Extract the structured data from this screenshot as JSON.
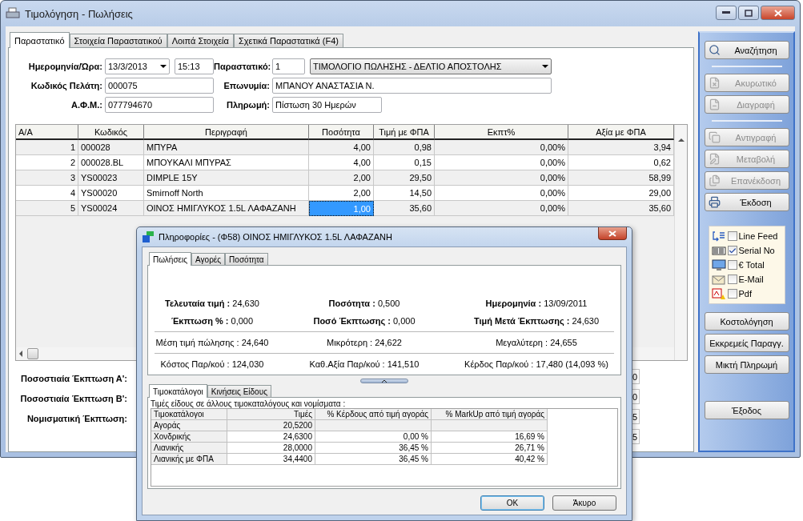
{
  "window": {
    "title": "Τιμολόγηση - Πωλήσεις"
  },
  "tabs": [
    {
      "label": "Παραστατικό",
      "selected": true
    },
    {
      "label": "Στοιχεία Παραστατικού",
      "selected": false
    },
    {
      "label": "Λοιπά Στοιχεία",
      "selected": false
    },
    {
      "label": "Σχετικά Παραστατικά (F4)",
      "selected": false
    }
  ],
  "form": {
    "date_label": "Ημερομηνία/Ώρα:",
    "date": "13/3/2013",
    "time": "15:13",
    "document_label": "Παραστατικό:",
    "document_number": "1",
    "document_type": "ΤΙΜΟΛΟΓΙΟ ΠΩΛΗΣΗΣ - ΔΕΛΤΙΟ ΑΠΟΣΤΟΛΗΣ",
    "customer_code_label": "Κωδικός Πελάτη:",
    "customer_code": "000075",
    "name_label": "Επωνυμία:",
    "name": "ΜΠΑΝΟΥ ΑΝΑΣΤΑΣΙΑ Ν.",
    "tax_id_label": "Α.Φ.Μ.:",
    "tax_id": "077794670",
    "payment_label": "Πληρωμή:",
    "payment": "Πίστωση 30 Ημερών"
  },
  "grid": {
    "columns": [
      "Α/Α",
      "Κωδικός",
      "Περιγραφή",
      "Ποσότητα",
      "Τιμή με ΦΠΑ",
      "Εκπτ%",
      "Αξία με ΦΠΑ"
    ],
    "rows": [
      {
        "cells": [
          "1",
          "000028",
          "ΜΠΥΡΑ",
          "4,00",
          "0,98",
          "0,00%",
          "3,94"
        ],
        "selected": false
      },
      {
        "cells": [
          "2",
          "000028.BL",
          "ΜΠΟΥΚΑΛΙ ΜΠΥΡΑΣ",
          "4,00",
          "0,15",
          "0,00%",
          "0,62"
        ],
        "selected": false
      },
      {
        "cells": [
          "3",
          "YS00023",
          "DIMPLE 15Y",
          "2,00",
          "29,50",
          "0,00%",
          "58,99"
        ],
        "selected": false
      },
      {
        "cells": [
          "4",
          "YS00020",
          "Smirnoff North",
          "2,00",
          "14,50",
          "0,00%",
          "29,00"
        ],
        "selected": false
      },
      {
        "cells": [
          "5",
          "YS00024",
          "ΟΙΝΟΣ ΗΜΙΓΛΥΚΟΣ 1.5L ΛΑΦΑΖΑΝΗ",
          "1,00",
          "35,60",
          "0,00%",
          "35,60"
        ],
        "selected": true
      }
    ]
  },
  "discounts": {
    "labels": [
      "Ποσοστιαία Έκπτωση  Α':",
      "Ποσοστιαία Έκπτωση  Β':",
      "Νομισματική Έκπτωση:"
    ],
    "values": [
      "0",
      "0",
      "5",
      "5"
    ]
  },
  "sidebar": {
    "button_groups": [
      [
        {
          "label": "Αναζήτηση",
          "disabled": false
        }
      ],
      [
        {
          "label": "Ακυρωτικό",
          "disabled": true
        },
        {
          "label": "Διαγραφή",
          "disabled": true
        }
      ],
      [
        {
          "label": "Αντιγραφή",
          "disabled": true
        },
        {
          "label": "Μεταβολή",
          "disabled": true
        },
        {
          "label": "Επανέκδοση",
          "disabled": true
        },
        {
          "label": "Έκδοση",
          "disabled": false
        }
      ]
    ],
    "options": [
      {
        "label": "Line Feed",
        "checked": false
      },
      {
        "label": "Serial No",
        "checked": true
      },
      {
        "label": "€ Total",
        "checked": false
      },
      {
        "label": "E-Mail",
        "checked": false
      },
      {
        "label": "Pdf",
        "checked": false
      }
    ],
    "lower_buttons": [
      "Κοστολόγηση",
      "Εκκρεμείς Παραγγ.",
      "Μικτή Πληρωμή"
    ],
    "exit_button": "Έξοδος"
  },
  "dialog": {
    "title": "Πληροφορίες - (Φ58) ΟΙΝΟΣ ΗΜΙΓΛΥΚΟΣ 1.5L  ΛΑΦΑΖΑΝΗ",
    "tabs": [
      {
        "label": "Πωλήσεις",
        "selected": true
      },
      {
        "label": "Αγορές",
        "selected": false
      },
      {
        "label": "Ποσότητα",
        "selected": false
      }
    ],
    "stats": [
      [
        "**Τελευταία τιμή :** 24,630",
        "**Ποσότητα :** 0,500",
        "**Ημερομηνία :** 13/09/2011"
      ],
      [
        "**Έκπτωση % :** 0,000",
        "**Ποσό Έκπτωσης :** 0,000",
        "**Τιμή Μετά Έκπτωσης :** 24,630"
      ],
      [
        "Μέση τιμή πώλησης : 24,640",
        "Μικρότερη : 24,622",
        "Μεγαλύτερη : 24,655"
      ],
      [
        "Κόστος Παρ/κού : 124,030",
        "Καθ.Αξία Παρ/κού : 141,510",
        "Κέρδος Παρ/κού : 17,480 (14,093 %)"
      ]
    ],
    "lower_tabs": [
      {
        "label": "Τιμοκατάλογοι",
        "selected": true
      },
      {
        "label": "Κινήσεις Είδους",
        "selected": false
      }
    ],
    "caption": "Τιμές είδους σε άλλους τιμοκαταλόγους και νομίσματα :",
    "table": {
      "columns": [
        "Τιμοκατάλογοι",
        "Τιμές",
        "% Κέρδους από τιμή αγοράς",
        "% MarkUp από τιμή αγοράς"
      ],
      "rows": [
        [
          "Αγοράς",
          "20,5200"
        ],
        [
          "Χονδρικής",
          "24,6300",
          "0,00 %",
          "16,69 %"
        ],
        [
          "Λιανικής",
          "28,0000",
          "36,45 %",
          "26,71 %"
        ],
        [
          "Λιανικής με ΦΠΑ",
          "34,4400",
          "36,45 %",
          "40,42 %"
        ]
      ]
    },
    "ok_button": "OK",
    "cancel_button": "Άκυρο"
  }
}
